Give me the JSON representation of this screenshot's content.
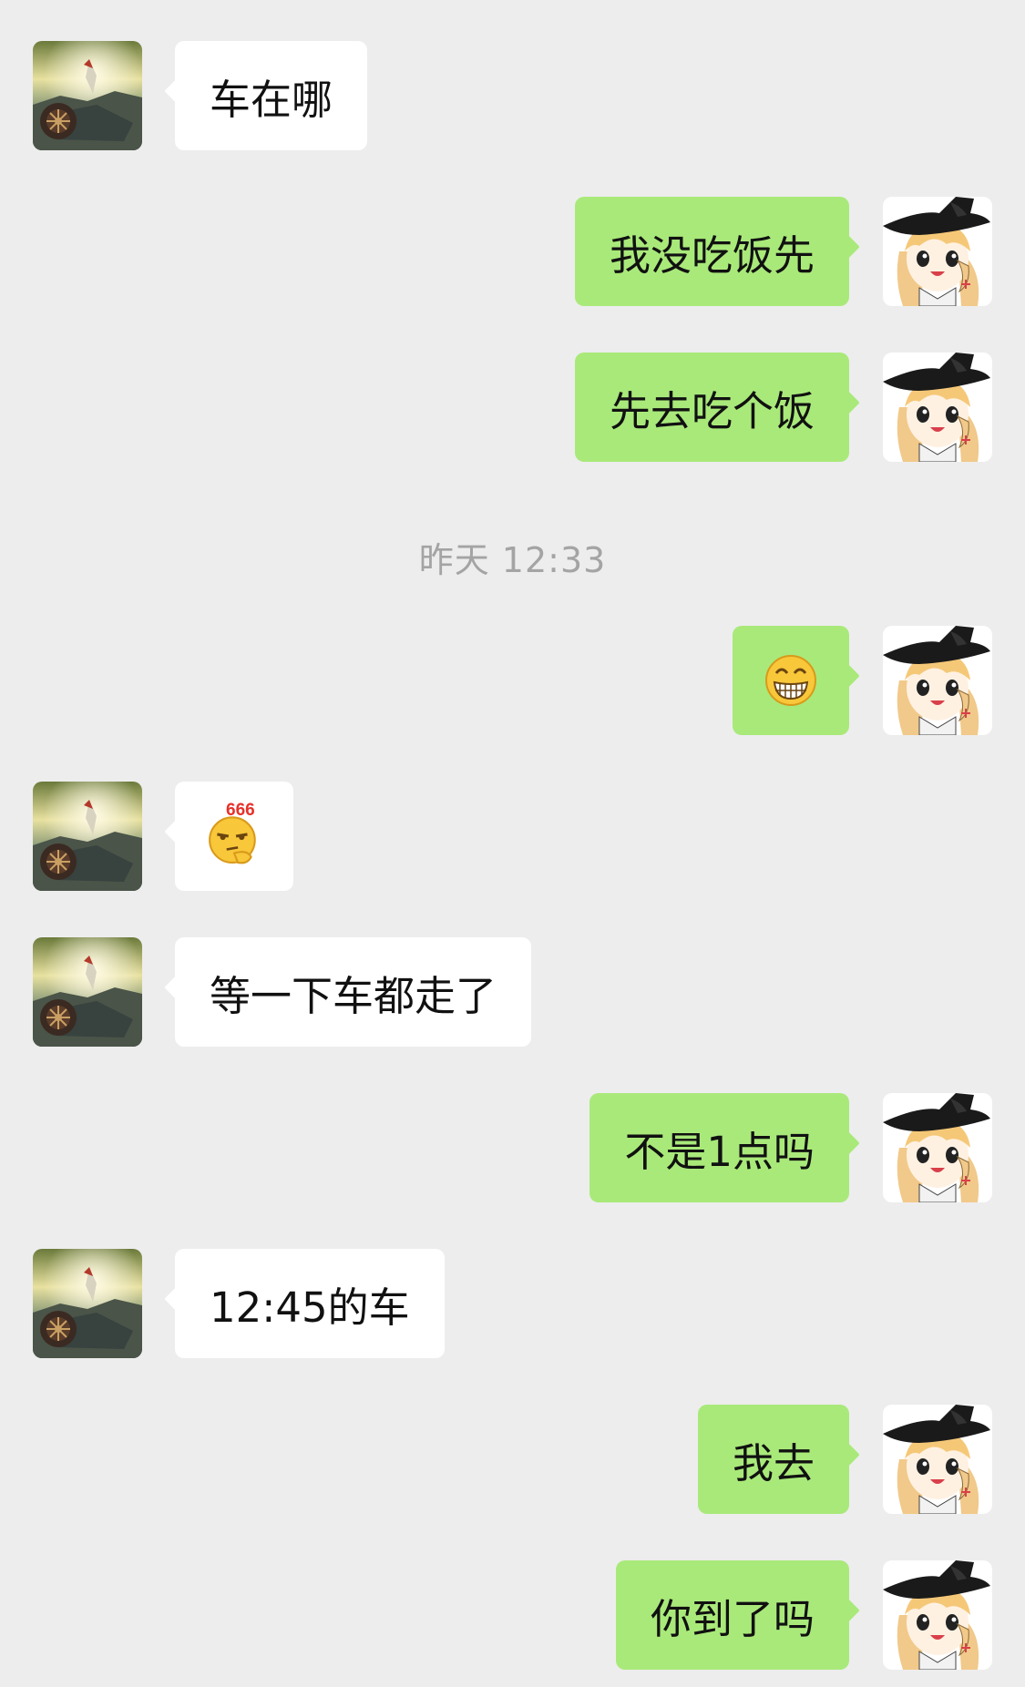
{
  "colors": {
    "background": "#ededed",
    "incoming_bubble": "#ffffff",
    "outgoing_bubble": "#a9e97a",
    "timestamp_text": "#a4a4a4"
  },
  "avatars": {
    "contact": "landscape-warrior-avatar-image",
    "self": "witch-girl-avatar-image"
  },
  "messages": [
    {
      "direction": "in",
      "text": "车在哪"
    },
    {
      "direction": "out",
      "text": "我没吃饭先"
    },
    {
      "direction": "out",
      "text": "先去吃个饭"
    },
    {
      "type": "timestamp",
      "text": "昨天 12:33"
    },
    {
      "direction": "out",
      "emoji": "grinning-face-emoji"
    },
    {
      "direction": "in",
      "emoji": "666-thinking-emoji",
      "text": "666"
    },
    {
      "direction": "in",
      "text": "等一下车都走了"
    },
    {
      "direction": "out",
      "text": "不是1点吗"
    },
    {
      "direction": "in",
      "text": "12:45的车"
    },
    {
      "direction": "out",
      "text": "我去"
    },
    {
      "direction": "out",
      "text": "你到了吗"
    }
  ]
}
